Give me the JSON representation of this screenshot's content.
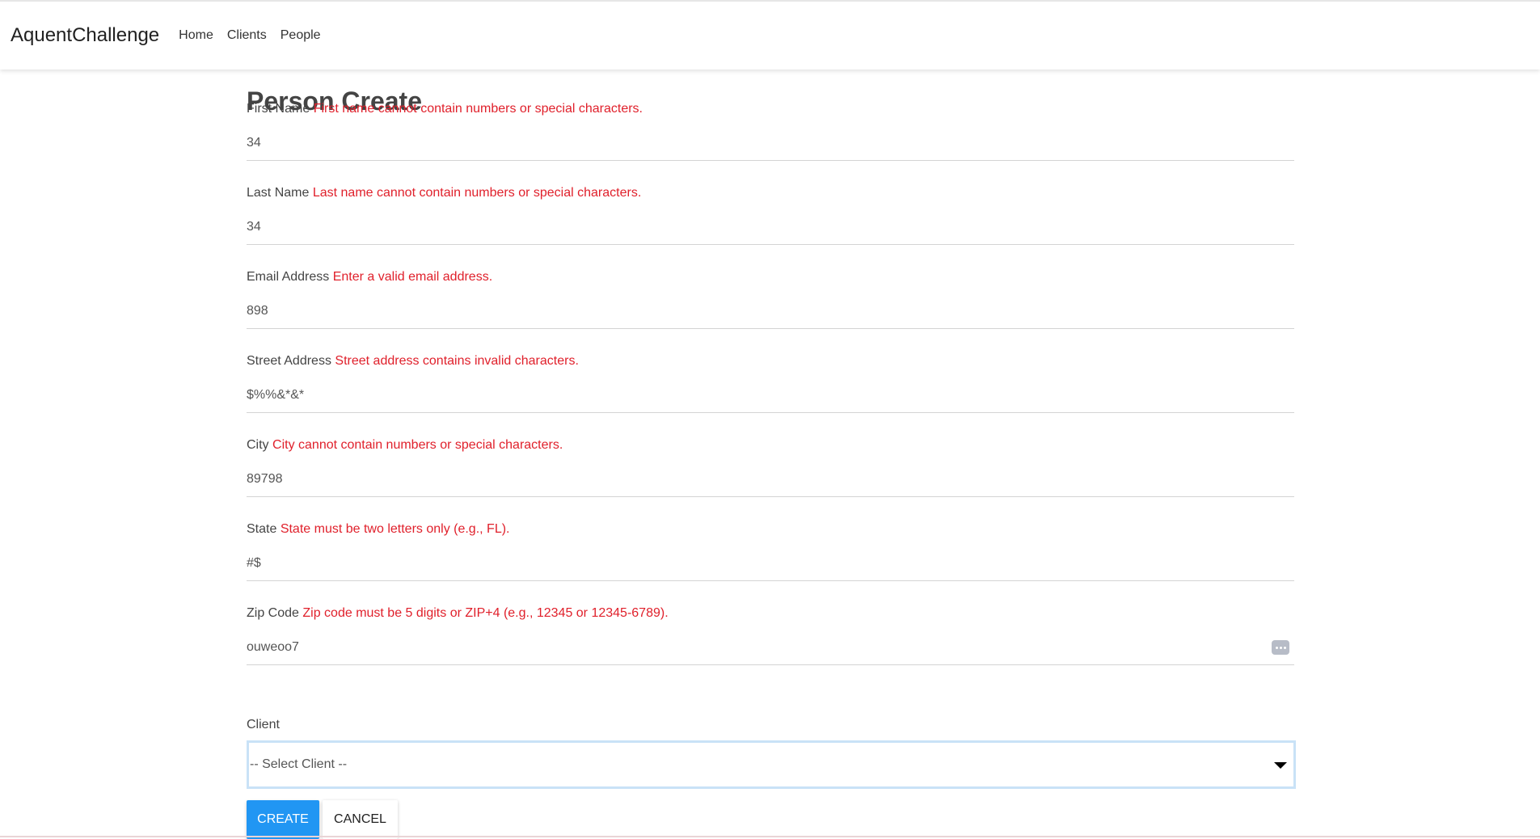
{
  "navbar": {
    "brand": "AquentChallenge",
    "links": [
      "Home",
      "Clients",
      "People"
    ]
  },
  "page": {
    "title": "Person Create"
  },
  "fields": [
    {
      "label": "First Name",
      "error": "First name cannot contain numbers or special characters.",
      "value": "34"
    },
    {
      "label": "Last Name",
      "error": "Last name cannot contain numbers or special characters.",
      "value": "34"
    },
    {
      "label": "Email Address",
      "error": "Enter a valid email address.",
      "value": "898"
    },
    {
      "label": "Street Address",
      "error": "Street address contains invalid characters.",
      "value": "$%%&*&*"
    },
    {
      "label": "City",
      "error": "City cannot contain numbers or special characters.",
      "value": "89798"
    },
    {
      "label": "State",
      "error": "State must be two letters only (e.g., FL).",
      "value": "#$"
    },
    {
      "label": "Zip Code",
      "error": "Zip code must be 5 digits or ZIP+4 (e.g., 12345 or 12345-6789).",
      "value": "ouweoo7"
    }
  ],
  "client": {
    "label": "Client",
    "selected": "-- Select Client --"
  },
  "buttons": {
    "create": "CREATE",
    "cancel": "CANCEL"
  },
  "colors": {
    "error": "#e0202b",
    "primary": "#2196f3",
    "select_focus_border": "#c9e2f7"
  },
  "icons": {
    "keyboard_helper": "keyboard-dots-icon",
    "dropdown": "caret-down-icon"
  }
}
